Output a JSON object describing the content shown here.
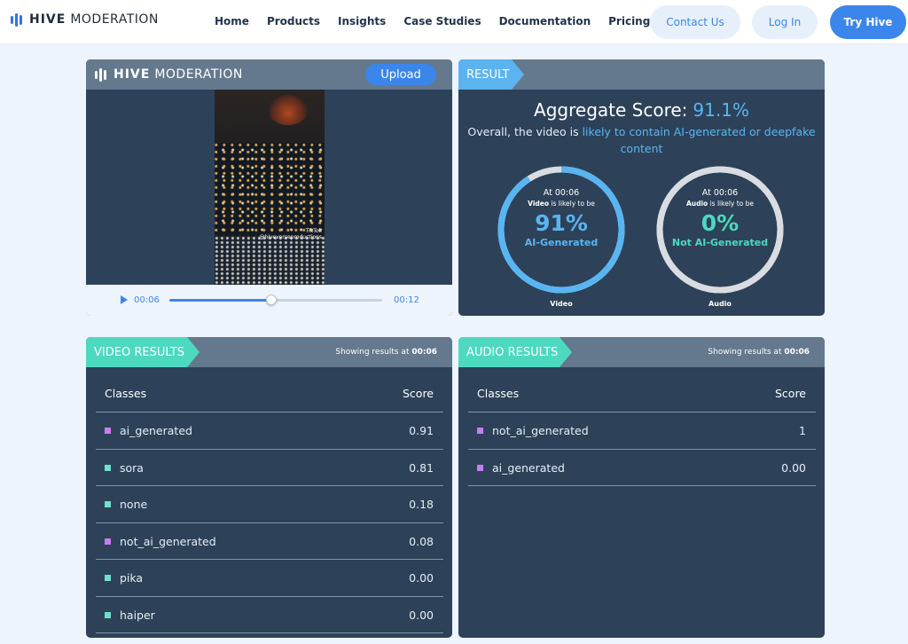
{
  "nav": {
    "brand_bold": "HIVE",
    "brand_light": "MODERATION",
    "links": [
      "Home",
      "Products",
      "Insights",
      "Case Studies",
      "Documentation",
      "Pricing"
    ],
    "contact": "Contact Us",
    "login": "Log In",
    "try": "Try Hive"
  },
  "player": {
    "brand_bold": "HIVE",
    "brand_light": "MODERATION",
    "upload": "Upload",
    "watermark_app": "TikTok",
    "watermark_user": "@hiveverseproductions",
    "current_time": "00:06",
    "end_time": "00:12",
    "progress": 0.48
  },
  "result": {
    "tag": "RESULT",
    "aggregate_label": "Aggregate Score:",
    "aggregate_value": "91.1%",
    "overall_prefix": "Overall, the video is ",
    "overall_highlight": "likely to contain AI-generated or deepfake content",
    "video": {
      "at": "At 00:06",
      "kind": "Video",
      "kind_suffix": " is likely to be",
      "pct": "91%",
      "label": "AI-Generated",
      "fraction": 0.91,
      "color": "#59b5f2",
      "caption": "Video"
    },
    "audio": {
      "at": "At 00:06",
      "kind": "Audio",
      "kind_suffix": " is likely to be",
      "pct": "0%",
      "label": "Not AI-Generated",
      "fraction": 1.0,
      "color": "#4dd9bf",
      "caption": "Audio"
    }
  },
  "video_results": {
    "tag": "VIDEO RESULTS",
    "showing_prefix": "Showing results at ",
    "showing_time": "00:06",
    "col_classes": "Classes",
    "col_score": "Score",
    "rows": [
      {
        "cls": "ai_generated",
        "score": "0.91",
        "color": "#c77df0"
      },
      {
        "cls": "sora",
        "score": "0.81",
        "color": "#6fe0cf"
      },
      {
        "cls": "none",
        "score": "0.18",
        "color": "#6fe0cf"
      },
      {
        "cls": "not_ai_generated",
        "score": "0.08",
        "color": "#c77df0"
      },
      {
        "cls": "pika",
        "score": "0.00",
        "color": "#6fe0cf"
      },
      {
        "cls": "haiper",
        "score": "0.00",
        "color": "#6fe0cf"
      }
    ]
  },
  "audio_results": {
    "tag": "AUDIO RESULTS",
    "showing_prefix": "Showing results at ",
    "showing_time": "00:06",
    "col_classes": "Classes",
    "col_score": "Score",
    "rows": [
      {
        "cls": "not_ai_generated",
        "score": "1",
        "color": "#c77df0"
      },
      {
        "cls": "ai_generated",
        "score": "0.00",
        "color": "#c77df0"
      }
    ]
  }
}
